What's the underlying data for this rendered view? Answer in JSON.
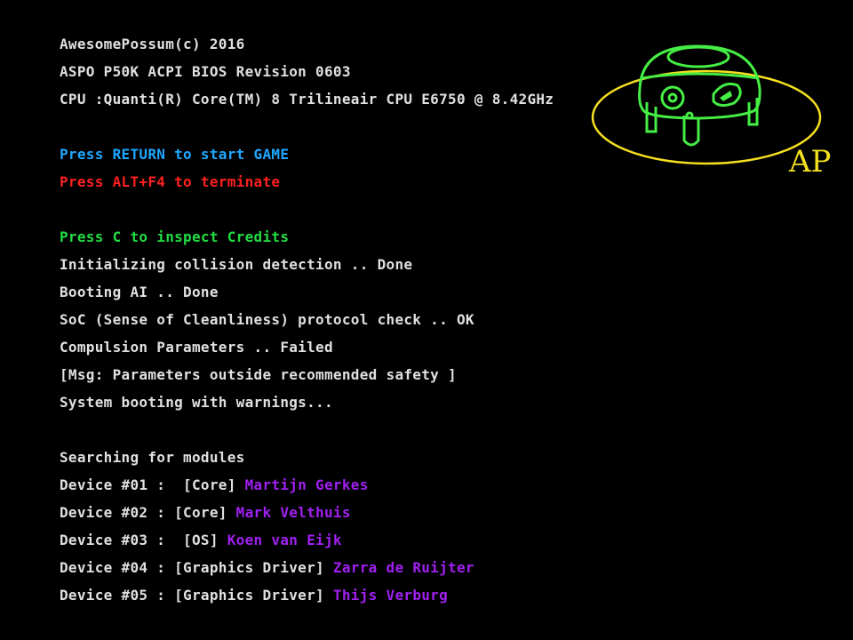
{
  "colors": {
    "text": "#e0e0e0",
    "start": "#1fa8ff",
    "terminate": "#ff2020",
    "credits": "#22dd44",
    "name": "#a020f0",
    "logo_ring": "#f5e020",
    "logo_robot": "#44ee44"
  },
  "header": {
    "copyright": "AwesomePossum(c) 2016",
    "bios": "ASPO P50K ACPI BIOS Revision 0603",
    "cpu": "CPU :Quanti(R) Core(TM) 8 Trilineair CPU E6750 @ 8.42GHz"
  },
  "menu": {
    "start": "Press RETURN to start GAME",
    "terminate": "Press ALT+F4 to terminate"
  },
  "boot": {
    "credits": "Press C to inspect Credits",
    "lines": [
      "Initializing collision detection .. Done",
      "Booting AI .. Done",
      "SoC (Sense of Cleanliness) protocol check .. OK",
      "Compulsion Parameters .. Failed",
      "[Msg: Parameters outside recommended safety ]",
      "System booting with warnings..."
    ]
  },
  "modules": {
    "title": "Searching for modules",
    "devices": [
      {
        "label": "Device #01 :  [Core] ",
        "name": "Martijn Gerkes"
      },
      {
        "label": "Device #02 : [Core] ",
        "name": "Mark Velthuis"
      },
      {
        "label": "Device #03 :  [OS] ",
        "name": "Koen van Eijk"
      },
      {
        "label": "Device #04 : [Graphics Driver] ",
        "name": "Zarra de Ruijter"
      },
      {
        "label": "Device #05 : [Graphics Driver] ",
        "name": "Thijs Verburg"
      }
    ]
  },
  "logo": {
    "text": "AP",
    "icon": "possum-robot-logo"
  }
}
